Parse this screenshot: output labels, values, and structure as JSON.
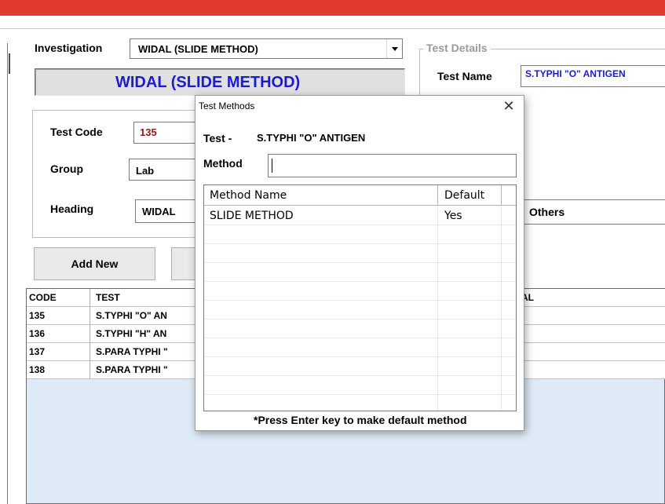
{
  "investigation": {
    "label": "Investigation",
    "selected": "WIDAL (SLIDE METHOD)",
    "banner": "WIDAL (SLIDE METHOD)"
  },
  "test_details": {
    "legend": "Test Details",
    "name_label": "Test Name",
    "name_value": "S.TYPHI \"O\" ANTIGEN"
  },
  "fields": {
    "code_label": "Test Code",
    "code_value": "135",
    "group_label": "Group",
    "group_value": "Lab",
    "heading_label": "Heading",
    "heading_value": "WIDAL",
    "others_value": "Others"
  },
  "buttons": {
    "add_new": "Add New"
  },
  "grid": {
    "columns": [
      "CODE",
      "TEST",
      "AL"
    ],
    "rows": [
      {
        "code": "135",
        "test": "S.TYPHI \"O\" AN"
      },
      {
        "code": "136",
        "test": "S.TYPHI \"H\" AN"
      },
      {
        "code": "137",
        "test": "S.PARA TYPHI \""
      },
      {
        "code": "138",
        "test": "S.PARA TYPHI \""
      }
    ]
  },
  "dialog": {
    "title": "Test Methods",
    "close": "✕",
    "test_label": "Test -",
    "test_value": "S.TYPHI \"O\" ANTIGEN",
    "method_label": "Method",
    "method_value": "",
    "list_headers": [
      "Method Name",
      "Default"
    ],
    "list_rows": [
      {
        "name": "SLIDE METHOD",
        "default": "Yes"
      }
    ],
    "footer": "*Press Enter key to make default method"
  }
}
